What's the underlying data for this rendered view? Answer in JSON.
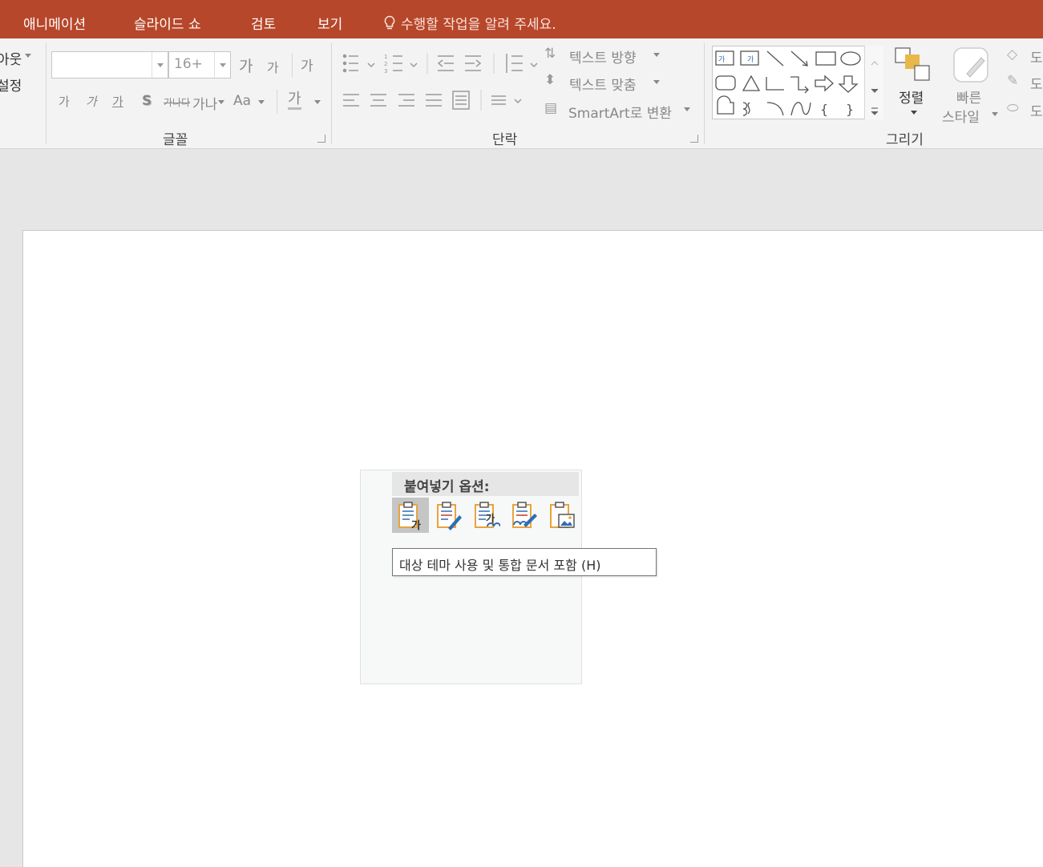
{
  "tabs": [
    "애니메이션",
    "슬라이드 쇼",
    "검토",
    "보기"
  ],
  "tell_me": "수행할 작업을 알려 주세요.",
  "ribbon": {
    "slides_group": {
      "layout_label": "아웃",
      "reset_label": "설정"
    },
    "font_group": {
      "label": "글꼴",
      "font_name_value": "",
      "font_size_value": "16+",
      "grow_font": "가",
      "shrink_font": "가",
      "clear_format": "가",
      "bold": "가",
      "italic": "가",
      "underline": "가",
      "shadow": "S",
      "strikethrough": "가나다",
      "spacing": "가나",
      "change_case": "Aa",
      "font_color": "가"
    },
    "paragraph_group": {
      "label": "단락",
      "text_direction": "텍스트 방향",
      "align_text": "텍스트 맞춤",
      "smartart": "SmartArt로 변환"
    },
    "drawing_group": {
      "label": "그리기",
      "arrange": "정렬",
      "quick_styles_line1": "빠른",
      "quick_styles_line2": "스타일",
      "shape_fill": "도",
      "shape_outline": "도",
      "shape_effects": "도"
    }
  },
  "paste_options": {
    "title": "붙여넣기 옵션:",
    "buttons": [
      {
        "name": "use-destination-theme",
        "icon": "paste-theme-icon"
      },
      {
        "name": "keep-source-formatting",
        "icon": "paste-brush-icon"
      },
      {
        "name": "embed",
        "icon": "paste-embed-icon"
      },
      {
        "name": "link",
        "icon": "paste-link-icon"
      },
      {
        "name": "picture",
        "icon": "paste-picture-icon"
      }
    ],
    "tooltip": "대상 테마 사용 및 통합 문서 포함 (H)"
  },
  "colors": {
    "title_bar": "#b7472a",
    "ribbon_bg": "#f3f3f3",
    "workspace_bg": "#e6e6e6",
    "paste_icon_orange": "#e8a33d",
    "paste_icon_blue": "#2e6db4"
  }
}
